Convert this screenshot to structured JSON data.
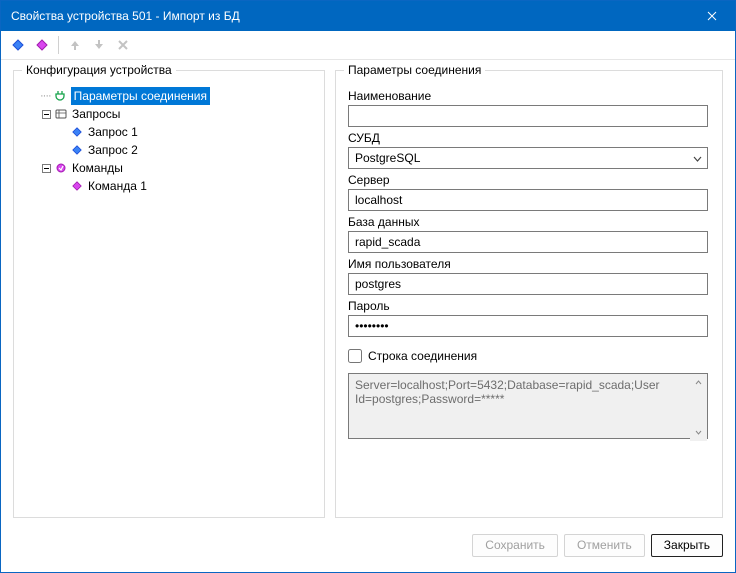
{
  "window": {
    "title": "Свойства устройства 501 - Импорт из БД"
  },
  "toolbar": {
    "add_blue": "add-diamond-blue-icon",
    "add_pink": "add-diamond-pink-icon",
    "move_up": "arrow-up-icon",
    "move_down": "arrow-down-icon",
    "delete": "delete-x-icon"
  },
  "left_panel": {
    "title": "Конфигурация устройства",
    "tree": {
      "connection": {
        "label": "Параметры соединения",
        "selected": true
      },
      "queries": {
        "label": "Запросы",
        "items": [
          {
            "label": "Запрос 1"
          },
          {
            "label": "Запрос 2"
          }
        ]
      },
      "commands": {
        "label": "Команды",
        "items": [
          {
            "label": "Команда 1"
          }
        ]
      }
    }
  },
  "right_panel": {
    "title": "Параметры соединения",
    "fields": {
      "name_label": "Наименование",
      "name_value": "",
      "dbms_label": "СУБД",
      "dbms_value": "PostgreSQL",
      "server_label": "Сервер",
      "server_value": "localhost",
      "database_label": "База данных",
      "database_value": "rapid_scada",
      "user_label": "Имя пользователя",
      "user_value": "postgres",
      "password_label": "Пароль",
      "password_value": "••••••••",
      "connstr_check_label": "Строка соединения",
      "connstr_value": "Server=localhost;Port=5432;Database=rapid_scada;User Id=postgres;Password=*****"
    }
  },
  "footer": {
    "save": "Сохранить",
    "cancel": "Отменить",
    "close": "Закрыть"
  }
}
